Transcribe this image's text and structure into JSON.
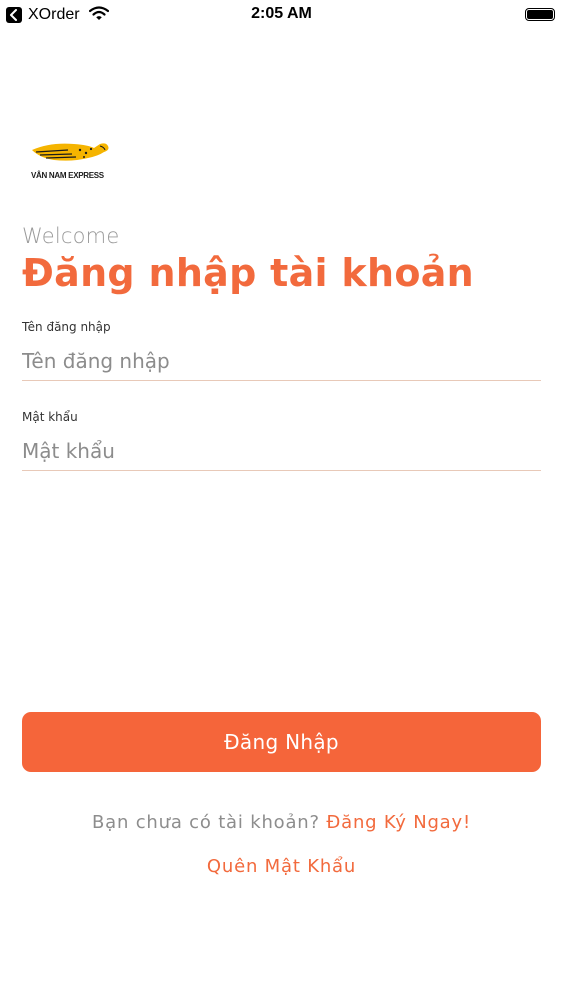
{
  "status_bar": {
    "back_app": "XOrder",
    "time": "2:05 AM",
    "icons": [
      "back-arrow-icon",
      "wifi-icon",
      "battery-icon"
    ]
  },
  "logo": {
    "text": "VÂN NAM EXPRESS",
    "colors": {
      "wing": "#f5b400",
      "text": "#1b1b1b"
    }
  },
  "header": {
    "welcome": "Welcome",
    "title": "Đăng nhập tài khoản"
  },
  "form": {
    "username": {
      "label": "Tên đăng nhập",
      "placeholder": "Tên đăng nhập",
      "value": ""
    },
    "password": {
      "label": "Mật khẩu",
      "placeholder": "Mật khẩu",
      "value": ""
    },
    "submit_label": "Đăng Nhập"
  },
  "footer": {
    "signup_prompt": "Bạn chưa có tài khoản?",
    "signup_link": "Đăng Ký Ngay!",
    "forgot_link": "Quên Mật Khẩu"
  },
  "colors": {
    "accent": "#f26a3d",
    "button": "#f5653a",
    "muted_text": "#8d8d8d",
    "divider": "#e8c9b8"
  }
}
